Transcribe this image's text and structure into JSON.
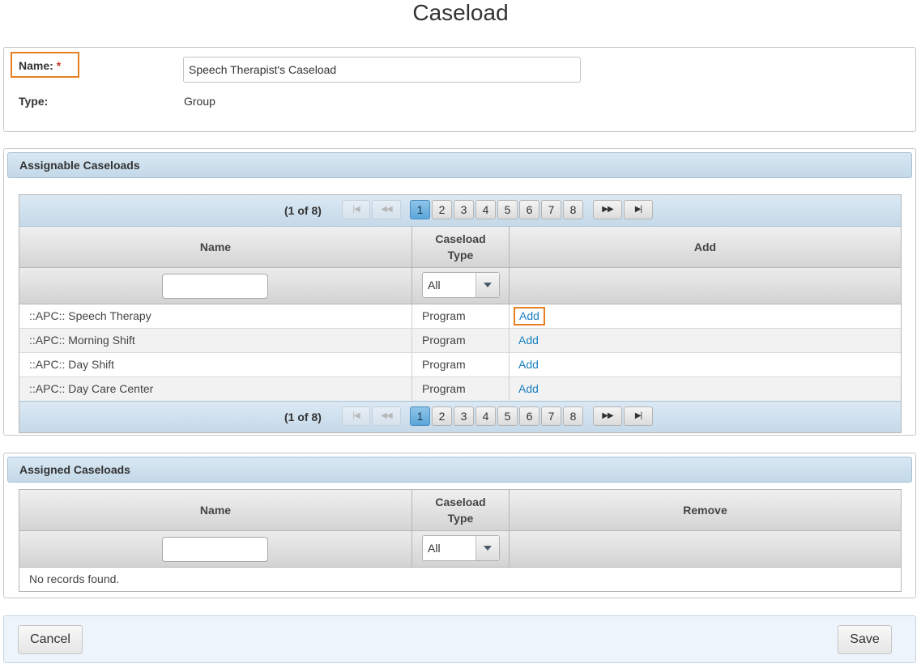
{
  "page": {
    "title": "Caseload"
  },
  "form": {
    "name_label": "Name:",
    "required_mark": "*",
    "name_value": "Speech Therapist's Caseload",
    "type_label": "Type:",
    "type_value": "Group"
  },
  "assignable": {
    "header": "Assignable Caseloads",
    "pager": {
      "count_text": "(1 of 8)",
      "first_icon": "first-page-icon",
      "prev_icon": "previous-page-icon",
      "next_icon": "next-page-icon",
      "last_icon": "last-page-icon",
      "pages": [
        "1",
        "2",
        "3",
        "4",
        "5",
        "6",
        "7",
        "8"
      ],
      "active_page": "1"
    },
    "columns": {
      "name": "Name",
      "type_line1": "Caseload",
      "type_line2": "Type",
      "action": "Add"
    },
    "filter": {
      "name_value": "",
      "type_value": "All"
    },
    "rows": [
      {
        "name": "::APC:: Speech Therapy",
        "type": "Program",
        "action": "Add"
      },
      {
        "name": "::APC:: Morning Shift",
        "type": "Program",
        "action": "Add"
      },
      {
        "name": "::APC:: Day Shift",
        "type": "Program",
        "action": "Add"
      },
      {
        "name": "::APC:: Day Care Center",
        "type": "Program",
        "action": "Add"
      }
    ]
  },
  "assigned": {
    "header": "Assigned Caseloads",
    "columns": {
      "name": "Name",
      "type_line1": "Caseload",
      "type_line2": "Type",
      "action": "Remove"
    },
    "filter": {
      "name_value": "",
      "type_value": "All"
    },
    "empty_text": "No records found."
  },
  "footer": {
    "cancel_label": "Cancel",
    "save_label": "Save"
  },
  "colors": {
    "highlight": "#e67e22",
    "link": "#1a7fc1",
    "required": "#c0392b"
  }
}
